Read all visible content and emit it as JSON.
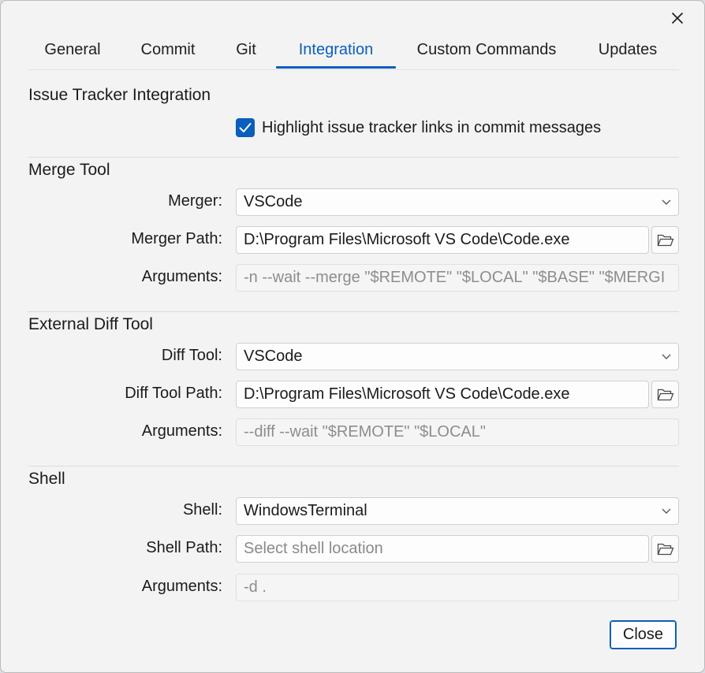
{
  "window": {
    "close_icon": "close-icon"
  },
  "tabs": [
    {
      "label": "General"
    },
    {
      "label": "Commit"
    },
    {
      "label": "Git"
    },
    {
      "label": "Integration",
      "active": true
    },
    {
      "label": "Custom Commands"
    },
    {
      "label": "Updates"
    }
  ],
  "issue_tracker": {
    "title": "Issue Tracker Integration",
    "highlight_checkbox_label": "Highlight issue tracker links in commit messages",
    "highlight_checked": true
  },
  "merge_tool": {
    "title": "Merge Tool",
    "merger_label": "Merger:",
    "merger_value": "VSCode",
    "path_label": "Merger Path:",
    "path_value": "D:\\Program Files\\Microsoft VS Code\\Code.exe",
    "arguments_label": "Arguments:",
    "arguments_value": "-n --wait --merge \"$REMOTE\" \"$LOCAL\" \"$BASE\" \"$MERGI"
  },
  "diff_tool": {
    "title": "External Diff Tool",
    "tool_label": "Diff Tool:",
    "tool_value": "VSCode",
    "path_label": "Diff Tool Path:",
    "path_value": "D:\\Program Files\\Microsoft VS Code\\Code.exe",
    "arguments_label": "Arguments:",
    "arguments_value": "--diff --wait \"$REMOTE\" \"$LOCAL\""
  },
  "shell": {
    "title": "Shell",
    "shell_label": "Shell:",
    "shell_value": "WindowsTerminal",
    "path_label": "Shell Path:",
    "path_placeholder": "Select shell location",
    "arguments_label": "Arguments:",
    "arguments_value": "-d ."
  },
  "footer": {
    "close_label": "Close"
  },
  "colors": {
    "accent": "#0a5ebd",
    "background": "#f3f3f3"
  }
}
